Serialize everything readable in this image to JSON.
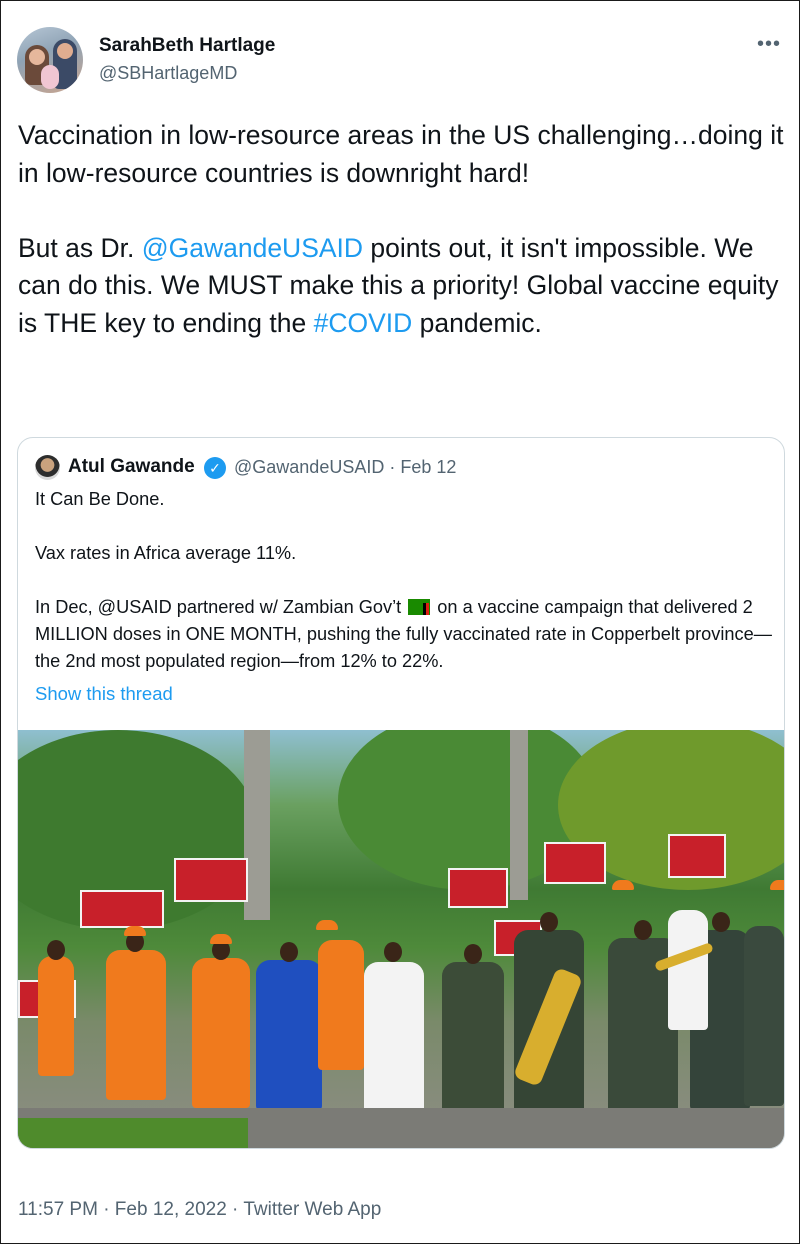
{
  "tweet": {
    "author_name": "SarahBeth Hartlage",
    "author_handle": "@SBHartlageMD",
    "more_label": "•••",
    "text_p1": "Vaccination in low-resource areas in the US challenging…doing it in low-resource countries is downright hard!",
    "text_p2_a": "But as Dr. ",
    "text_p2_mention": "@GawandeUSAID",
    "text_p2_b": " points out, it isn't impossible. We can do this. We MUST make this a priority! Global vaccine equity is THE key to ending the ",
    "text_p2_hashtag": "#COVID",
    "text_p2_c": " pandemic.",
    "footer": "11:57 PM · Feb 12, 2022 · Twitter Web App"
  },
  "quote": {
    "author_name": "Atul Gawande",
    "verified_glyph": "✓",
    "meta": "@GawandeUSAID · Feb 12",
    "line1": "It Can Be Done.",
    "line2": "Vax rates in Africa average 11%.",
    "line3_a": "In Dec, @USAID partnered w/ Zambian Gov’t",
    "line3_b": " on a vaccine campaign that delivered 2 MILLION doses in ONE MONTH, pushing the fully vaccinated rate in Copperbelt province—the 2nd most populated region—from 12% to 22%.",
    "show_thread": "Show this thread"
  },
  "icons": {
    "more": "more-horizontal-icon",
    "verified": "verified-badge-icon",
    "flag": "zambia-flag-icon"
  },
  "colors": {
    "link": "#1d9bf0",
    "secondary_text": "#536471",
    "border": "#cfd9de"
  }
}
